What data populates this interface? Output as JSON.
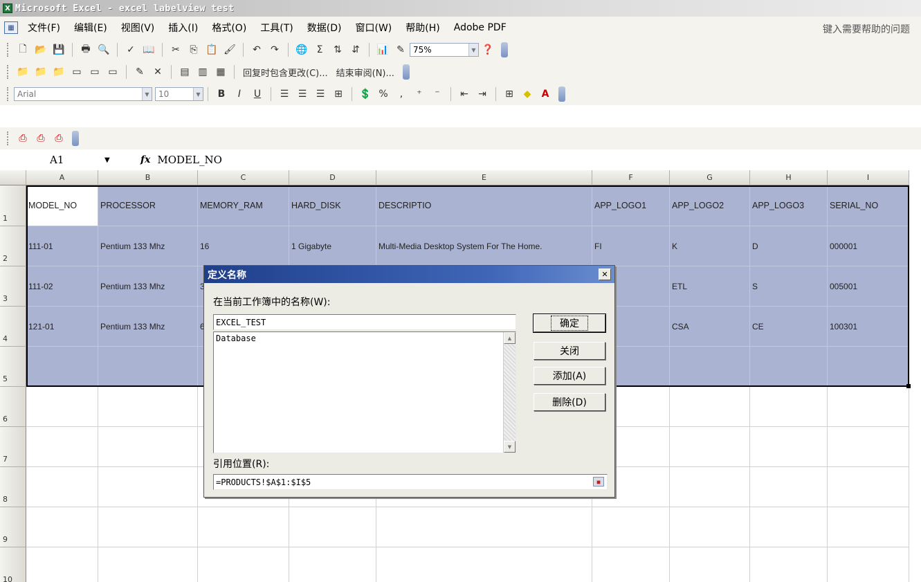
{
  "window": {
    "title": "Microsoft Excel - excel labelview test"
  },
  "menu": {
    "items": [
      "文件(F)",
      "编辑(E)",
      "视图(V)",
      "插入(I)",
      "格式(O)",
      "工具(T)",
      "数据(D)",
      "窗口(W)",
      "帮助(H)",
      "Adobe PDF"
    ],
    "help_placeholder": "键入需要帮助的问题"
  },
  "toolbar": {
    "zoom": "75%",
    "review_reply": "回复时包含更改(C)...",
    "review_end": "结束审阅(N)...",
    "font_name": "Arial",
    "font_size": "10",
    "bold": "B",
    "italic": "I",
    "underline": "U",
    "percent": "%",
    "comma": ","
  },
  "formula_bar": {
    "name_box": "A1",
    "fx": "fx",
    "formula": "MODEL_NO"
  },
  "sheet": {
    "columns": [
      "A",
      "B",
      "C",
      "D",
      "E",
      "F",
      "G",
      "H",
      "I"
    ],
    "rows": [
      "1",
      "2",
      "3",
      "4",
      "5",
      "6",
      "7",
      "8",
      "9",
      "10"
    ],
    "cells": [
      [
        "MODEL_NO",
        "PROCESSOR",
        "MEMORY_RAM",
        "HARD_DISK",
        "DESCRIPTIO",
        "APP_LOGO1",
        "APP_LOGO2",
        "APP_LOGO3",
        "SERIAL_NO"
      ],
      [
        "111-01",
        "Pentium 133 Mhz",
        "16",
        "1 Gigabyte",
        "Multi-Media Desktop System For The Home.",
        "FI",
        "K",
        "D",
        "000001"
      ],
      [
        "111-02",
        "Pentium 133 Mhz",
        "3",
        "",
        "",
        "",
        "ETL",
        "S",
        "005001"
      ],
      [
        "121-01",
        "Pentium 133 Mhz",
        "6",
        "",
        "",
        "",
        "CSA",
        "CE",
        "100301"
      ],
      [
        "",
        "",
        "",
        "",
        "",
        "",
        "",
        "",
        ""
      ]
    ]
  },
  "dialog": {
    "title": "定义名称",
    "names_label": "在当前工作簿中的名称(W):",
    "name_value": "EXCEL_TEST",
    "list_items": [
      "Database"
    ],
    "refers_label": "引用位置(R):",
    "refers_value": "=PRODUCTS!$A$1:$I$5",
    "ok": "确定",
    "close": "关闭",
    "add": "添加(A)",
    "delete": "删除(D)",
    "close_glyph": "✕"
  }
}
